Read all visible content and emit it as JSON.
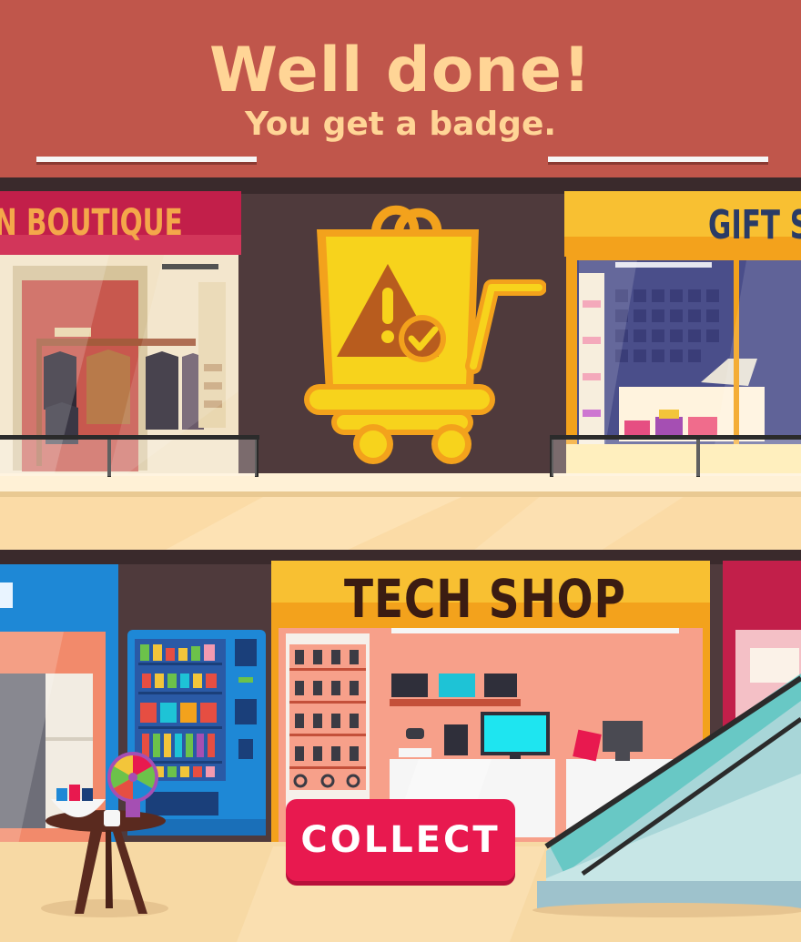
{
  "banner": {
    "title": "Well done!",
    "subtitle": "You get a badge."
  },
  "stores": {
    "boutique_sign": "N BOUTIQUE",
    "gift_sign": "GIFT S",
    "tech_sign": "TECH SHOP"
  },
  "actions": {
    "collect_label": "COLLECT"
  },
  "badge": {
    "icon": "shopping-cart-warning-check-icon"
  },
  "colors": {
    "banner": "#c0564b",
    "title_text": "#ffd596",
    "collect_button": "#e8194f",
    "badge_gold": "#f7d31c"
  }
}
